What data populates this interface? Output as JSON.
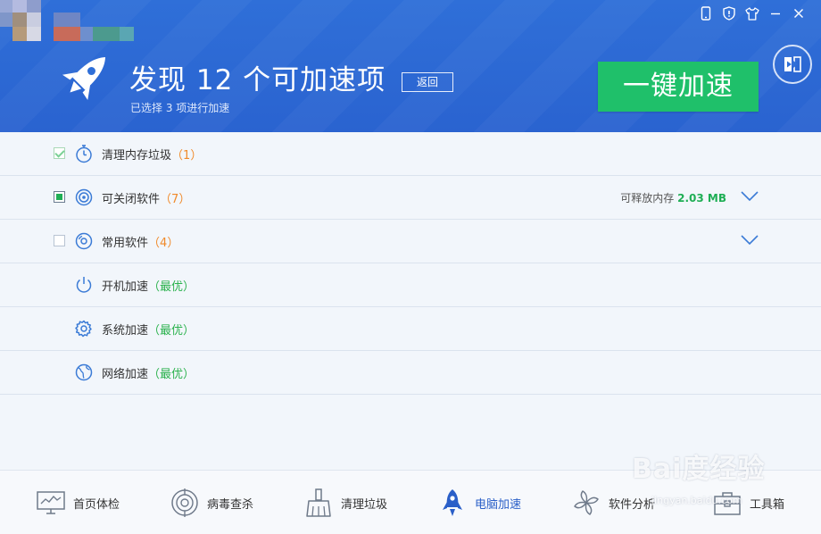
{
  "header": {
    "title": "发现 12 个可加速项",
    "subtitle": "已选择 3 项进行加速",
    "back_label": "返回",
    "primary_action_label": "一键加速"
  },
  "colors": {
    "header_blue": "#2f6fd8",
    "accent_green": "#1fc06a",
    "count_orange": "#f08a2a",
    "best_green": "#2cb24e",
    "active_nav_blue": "#2a5fc8"
  },
  "titlebar_icons": [
    "phone-icon",
    "shield-icon",
    "shirt-icon",
    "minimize-icon",
    "close-icon"
  ],
  "rows": [
    {
      "label": "清理内存垃圾",
      "open": "（",
      "count": "1",
      "close": "）",
      "icon": "stopwatch-icon",
      "checkbox": "checked-disabled"
    },
    {
      "label": "可关闭软件",
      "open": "（",
      "count": "7",
      "close": "）",
      "icon": "target-icon",
      "checkbox": "partial",
      "right_text": "可释放内存",
      "right_value": "2.03 MB",
      "expandable": true
    },
    {
      "label": "常用软件",
      "open": "（",
      "count": "4",
      "close": "）",
      "icon": "disc-icon",
      "checkbox": "unchecked",
      "expandable": true
    },
    {
      "label": "开机加速",
      "open": "（",
      "status": "最优",
      "close": "）",
      "icon": "power-icon"
    },
    {
      "label": "系统加速",
      "open": "（",
      "status": "最优",
      "close": "）",
      "icon": "gear-icon"
    },
    {
      "label": "网络加速",
      "open": "（",
      "status": "最优",
      "close": "）",
      "icon": "globe-icon"
    }
  ],
  "bottom_nav": [
    {
      "label": "首页体检",
      "icon": "monitor-chart-icon"
    },
    {
      "label": "病毒查杀",
      "icon": "radar-target-icon"
    },
    {
      "label": "清理垃圾",
      "icon": "broom-icon"
    },
    {
      "label": "电脑加速",
      "icon": "rocket-icon",
      "active": true
    },
    {
      "label": "软件分析",
      "icon": "pinwheel-icon"
    },
    {
      "label": "工具箱",
      "icon": "toolbox-icon"
    }
  ],
  "watermark": {
    "text": "Bai度经验",
    "url": "jingyan.baidu.com"
  }
}
